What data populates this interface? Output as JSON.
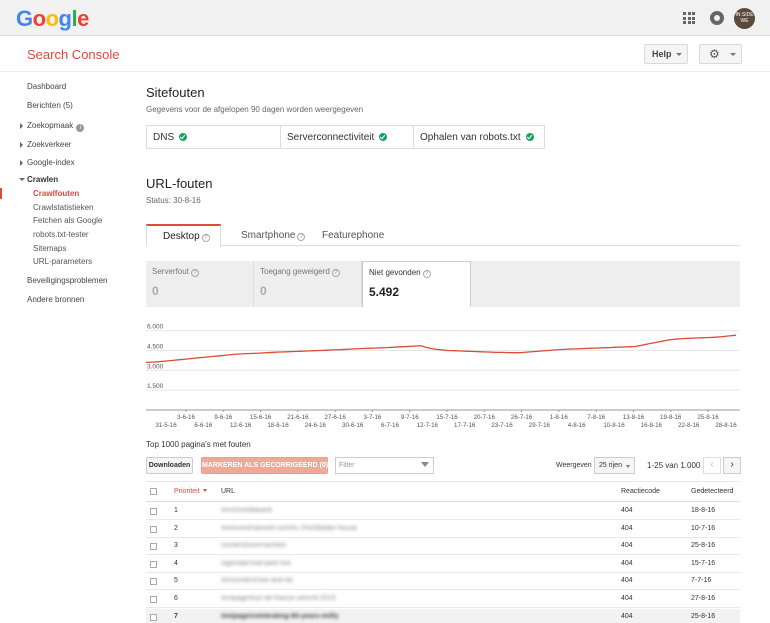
{
  "topbar": {
    "logo_letters": [
      {
        "ch": "G",
        "color": "#4285f4"
      },
      {
        "ch": "o",
        "color": "#ea4335"
      },
      {
        "ch": "o",
        "color": "#fbbc05"
      },
      {
        "ch": "g",
        "color": "#4285f4"
      },
      {
        "ch": "l",
        "color": "#34a853"
      },
      {
        "ch": "e",
        "color": "#ea4335"
      }
    ],
    "avatar_text": "IN SIDE WE"
  },
  "header": {
    "title": "Search Console",
    "help_label": "Help"
  },
  "sidebar": {
    "dashboard": "Dashboard",
    "berichten": "Berichten (5)",
    "zoekopmaak": "Zoekopmaak",
    "zoekverkeer": "Zoekverkeer",
    "google_index": "Google-index",
    "crawlen": "Crawlen",
    "crawl_items": [
      "Crawlfouten",
      "Crawlstatistieken",
      "Fetchen als Google",
      "robots.txt-tester",
      "Sitemaps",
      "URL-parameters"
    ],
    "beveiliging": "Beveiligingsproblemen",
    "andere": "Andere bronnen"
  },
  "site_errors": {
    "title": "Sitefouten",
    "subtitle": "Gegevens voor de afgelopen 90 dagen worden weergegeven",
    "cells": [
      "DNS",
      "Serverconnectiviteit",
      "Ophalen van robots.txt"
    ]
  },
  "url_errors": {
    "title": "URL-fouten",
    "status": "Status: 30-8-16",
    "tabs": [
      "Desktop",
      "Smartphone",
      "Featurephone"
    ],
    "metrics": [
      {
        "label": "Serverfout",
        "value": "0"
      },
      {
        "label": "Toegang geweigerd",
        "value": "0"
      },
      {
        "label": "Niet gevonden",
        "value": "5.492"
      }
    ]
  },
  "chart_data": {
    "type": "line",
    "yticks": [
      "6.000",
      "4.500",
      "3.000",
      "1.500"
    ],
    "ylim": [
      0,
      6500
    ],
    "xticks_top": [
      "3-6-16",
      "9-6-16",
      "15-6-16",
      "21-6-16",
      "27-6-16",
      "3-7-16",
      "9-7-16",
      "15-7-16",
      "20-7-16",
      "26-7-16",
      "1-8-16",
      "7-8-16",
      "13-8-16",
      "19-8-16",
      "25-8-16"
    ],
    "xticks_bottom": [
      "31-5-16",
      "6-6-16",
      "12-6-16",
      "18-6-16",
      "24-6-16",
      "30-6-16",
      "6-7-16",
      "12-7-16",
      "17-7-16",
      "23-7-16",
      "29-7-16",
      "4-8-16",
      "10-8-16",
      "16-8-16",
      "22-8-16",
      "28-8-16"
    ],
    "series": [
      {
        "color": "#dd4b39",
        "values": [
          3600,
          3620,
          3650,
          3700,
          3750,
          3800,
          3850,
          3900,
          3950,
          4000,
          4050,
          4100,
          4150,
          4200,
          4230,
          4260,
          4280,
          4300,
          4330,
          4360,
          4380,
          4400,
          4420,
          4440,
          4460,
          4480,
          4500,
          4520,
          4540,
          4560,
          4590,
          4620,
          4640,
          4660,
          4680,
          4700,
          4720,
          4750,
          4780,
          4800,
          4830,
          4850,
          4700,
          4600,
          4550,
          4500,
          4480,
          4460,
          4440,
          4420,
          4400,
          4380,
          4360,
          4350,
          4340,
          4330,
          4340,
          4380,
          4420,
          4460,
          4500,
          4540,
          4570,
          4600,
          4620,
          4640,
          4660,
          4680,
          4700,
          4720,
          4740,
          4760,
          4780,
          4800,
          4900,
          5000,
          5100,
          5200,
          5300,
          5350,
          5400,
          5420,
          5440,
          5460,
          5480,
          5500,
          5550,
          5600,
          5650
        ]
      }
    ]
  },
  "table": {
    "caption": "Top 1000 pagina's met fouten",
    "download_label": "Downloaden",
    "mark_label": "MARKEREN ALS GECORRIGEERD (0)",
    "filter_placeholder": "Filter",
    "show_label": "Weergeven",
    "rows_select": "25 rijen",
    "range": "1-25 van 1.000",
    "prev": "‹",
    "next": "›",
    "headers": {
      "priority": "Prioriteit",
      "url": "URL",
      "code": "Reactiecode",
      "detected": "Gedetecteerd"
    },
    "rows": [
      {
        "priority": "1",
        "url": "/en/x/mediabank",
        "code": "404",
        "detected": "18-8-16"
      },
      {
        "priority": "2",
        "url": "/en/event/rahmeh-schrhc-2%20bilder-house",
        "code": "404",
        "detected": "10-7-16"
      },
      {
        "priority": "3",
        "url": "/content/overnachten",
        "code": "404",
        "detected": "25-8-16"
      },
      {
        "priority": "4",
        "url": "/agenda/rural-park-live",
        "code": "404",
        "detected": "15-7-16"
      },
      {
        "priority": "5",
        "url": "/en/content/see-and-do",
        "code": "404",
        "detected": "7-7-16"
      },
      {
        "priority": "6",
        "url": "/en/page/tour-de-france-utrecht-2015",
        "code": "404",
        "detected": "27-8-16"
      },
      {
        "priority": "7",
        "url": "/en/page/celebrating-60-years-miffy",
        "code": "404",
        "detected": "25-8-16"
      }
    ]
  }
}
